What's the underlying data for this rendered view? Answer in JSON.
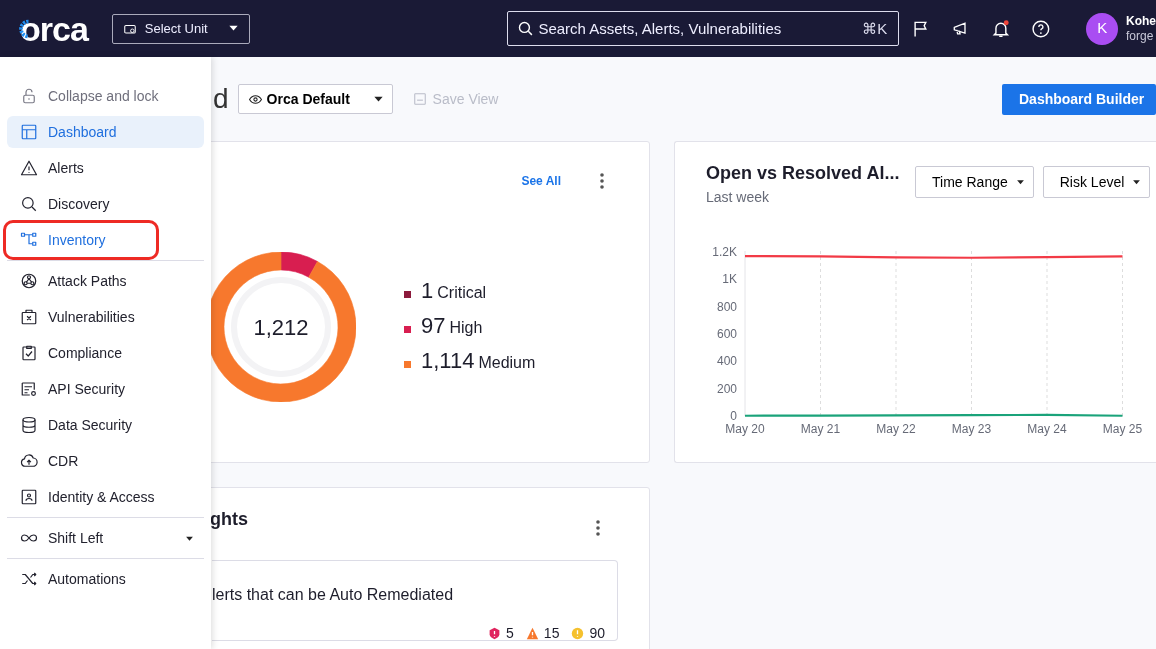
{
  "topbar": {
    "logo": "orca",
    "unit_select": {
      "label": "Select Unit"
    },
    "search": {
      "placeholder": "Search Assets, Alerts, Vulnerabilities",
      "shortcut": "⌘K"
    },
    "notifications_unread": true,
    "user": {
      "initial": "K",
      "name": "Kohe",
      "org": "forge"
    }
  },
  "sidebar": {
    "items": [
      {
        "label": "Collapse and lock",
        "kind": "action",
        "selected": false,
        "hovered": false,
        "outlined": false,
        "divider_after": false
      },
      {
        "label": "Dashboard",
        "kind": "link",
        "selected": true,
        "hovered": false,
        "outlined": false,
        "divider_after": false
      },
      {
        "label": "Alerts",
        "kind": "link",
        "selected": false,
        "hovered": false,
        "outlined": false,
        "divider_after": false
      },
      {
        "label": "Discovery",
        "kind": "link",
        "selected": false,
        "hovered": false,
        "outlined": false,
        "divider_after": false
      },
      {
        "label": "Inventory",
        "kind": "link",
        "selected": false,
        "hovered": true,
        "outlined": true,
        "divider_after": true
      },
      {
        "label": "Attack Paths",
        "kind": "link",
        "selected": false,
        "hovered": false,
        "outlined": false,
        "divider_after": false
      },
      {
        "label": "Vulnerabilities",
        "kind": "link",
        "selected": false,
        "hovered": false,
        "outlined": false,
        "divider_after": false
      },
      {
        "label": "Compliance",
        "kind": "link",
        "selected": false,
        "hovered": false,
        "outlined": false,
        "divider_after": false
      },
      {
        "label": "API Security",
        "kind": "link",
        "selected": false,
        "hovered": false,
        "outlined": false,
        "divider_after": false
      },
      {
        "label": "Data Security",
        "kind": "link",
        "selected": false,
        "hovered": false,
        "outlined": false,
        "divider_after": false
      },
      {
        "label": "CDR",
        "kind": "link",
        "selected": false,
        "hovered": false,
        "outlined": false,
        "divider_after": false
      },
      {
        "label": "Identity & Access",
        "kind": "link",
        "selected": false,
        "hovered": false,
        "outlined": false,
        "divider_after": true
      },
      {
        "label": "Shift Left",
        "kind": "group",
        "expanded": false,
        "selected": false,
        "hovered": false,
        "outlined": false,
        "divider_after": true
      },
      {
        "label": "Automations",
        "kind": "link",
        "selected": false,
        "hovered": false,
        "outlined": false,
        "divider_after": false
      }
    ]
  },
  "toolbar": {
    "title": "d",
    "view_select": {
      "label": "Orca Default"
    },
    "save_view": {
      "label": "Save View",
      "disabled": true
    },
    "builder_button": {
      "label": "Dashboard Builder"
    }
  },
  "alerts_card": {
    "link": "See All",
    "total": "1,212",
    "legend": [
      {
        "count": "1",
        "label": "Critical",
        "color": "#8c1a3c"
      },
      {
        "count": "97",
        "label": "High",
        "color": "#d81e50"
      },
      {
        "count": "1,114",
        "label": "Medium",
        "color": "#f7782d"
      }
    ]
  },
  "trend_card": {
    "title": "Open vs Resolved Al...",
    "subtitle": "Last week",
    "filters": [
      {
        "label": "Time Range"
      },
      {
        "label": "Risk Level"
      }
    ],
    "chart_data": {
      "type": "line",
      "grid": true,
      "categories": [
        "May 20",
        "May 21",
        "May 22",
        "May 23",
        "May 24",
        "May 25"
      ],
      "ylim": [
        0,
        1200
      ],
      "yticks": [
        0,
        200,
        400,
        600,
        800,
        {
          "value": 1000,
          "label": "1K"
        },
        {
          "value": 1200,
          "label": "1.2K"
        }
      ],
      "series": [
        {
          "color": "#f23a46",
          "values": [
            1170,
            1168,
            1160,
            1158,
            1162,
            1168
          ]
        },
        {
          "color": "#1aa37a",
          "values": [
            2,
            3,
            5,
            6,
            8,
            2
          ]
        }
      ]
    }
  },
  "insights_card": {
    "title": "ghts",
    "items": [
      {
        "text": "lerts that can be Auto Remediated",
        "counts": [
          {
            "kind": "critical",
            "value": "5",
            "color": "#e0245e"
          },
          {
            "kind": "high",
            "value": "15",
            "color": "#f7782d"
          },
          {
            "kind": "medium",
            "value": "90",
            "color": "#f5c12e"
          }
        ]
      }
    ]
  }
}
